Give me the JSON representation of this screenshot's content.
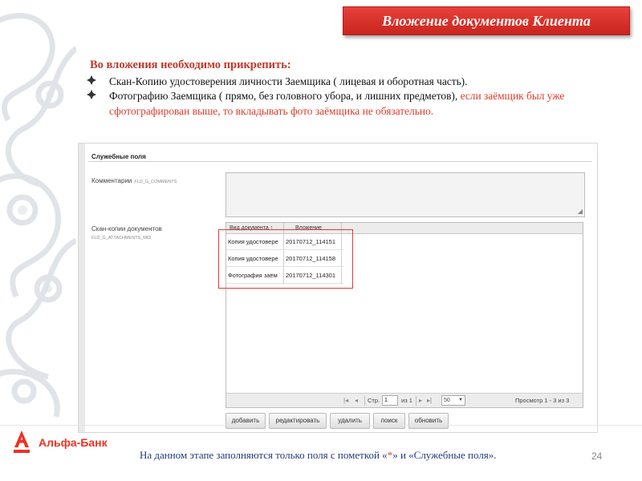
{
  "slide": {
    "title": "Вложение документов Клиента",
    "page_number": "24"
  },
  "instructions": {
    "heading": "Во вложения необходимо прикрепить:",
    "item1": "Скан-Копию удостоверения личности Заемщика ( лицевая и оборотная часть).",
    "item2_black": "Фотографию Заемщика ( прямо, без головного убора, и лишних предметов), ",
    "item2_red": "если заёмщик был уже сфотографирован выше, то вкладывать фото заёмщика не обязательно."
  },
  "form": {
    "section_title": "Служебные поля",
    "comments_label": "Комментарии",
    "comments_code": "FLD_G_COMMENTS",
    "comments_value": "",
    "attachments_label": "Скан-копии документов",
    "attachments_code": "FLD_G_ATTACHMENTS_MID",
    "grid": {
      "columns": [
        "Вид документа ↑",
        "Вложение"
      ],
      "rows": [
        [
          "Копия удостовере",
          "20170712_114151"
        ],
        [
          "Копия удостовере",
          "20170712_114158"
        ],
        [
          "Фотография заём",
          "20170712_114301"
        ]
      ]
    },
    "pager": {
      "page_label": "Стр.",
      "page_value": "1",
      "of_label": "из 1",
      "page_size": "50",
      "summary": "Просмотр 1 - 3 из 3"
    },
    "actions": {
      "add": "добавить",
      "edit": "редактировать",
      "delete": "удалить",
      "search": "поиск",
      "refresh": "обновить"
    }
  },
  "footer": {
    "bank_name": "Альфа-Банк",
    "note_before": "На данном этапе заполняются только поля с пометкой «",
    "note_star": "*",
    "note_after": "» и «Служебные поля»."
  },
  "colors": {
    "accent_red": "#e03a2c",
    "title_bg": "#d5302a",
    "footer_blue": "#1f3a7a"
  }
}
